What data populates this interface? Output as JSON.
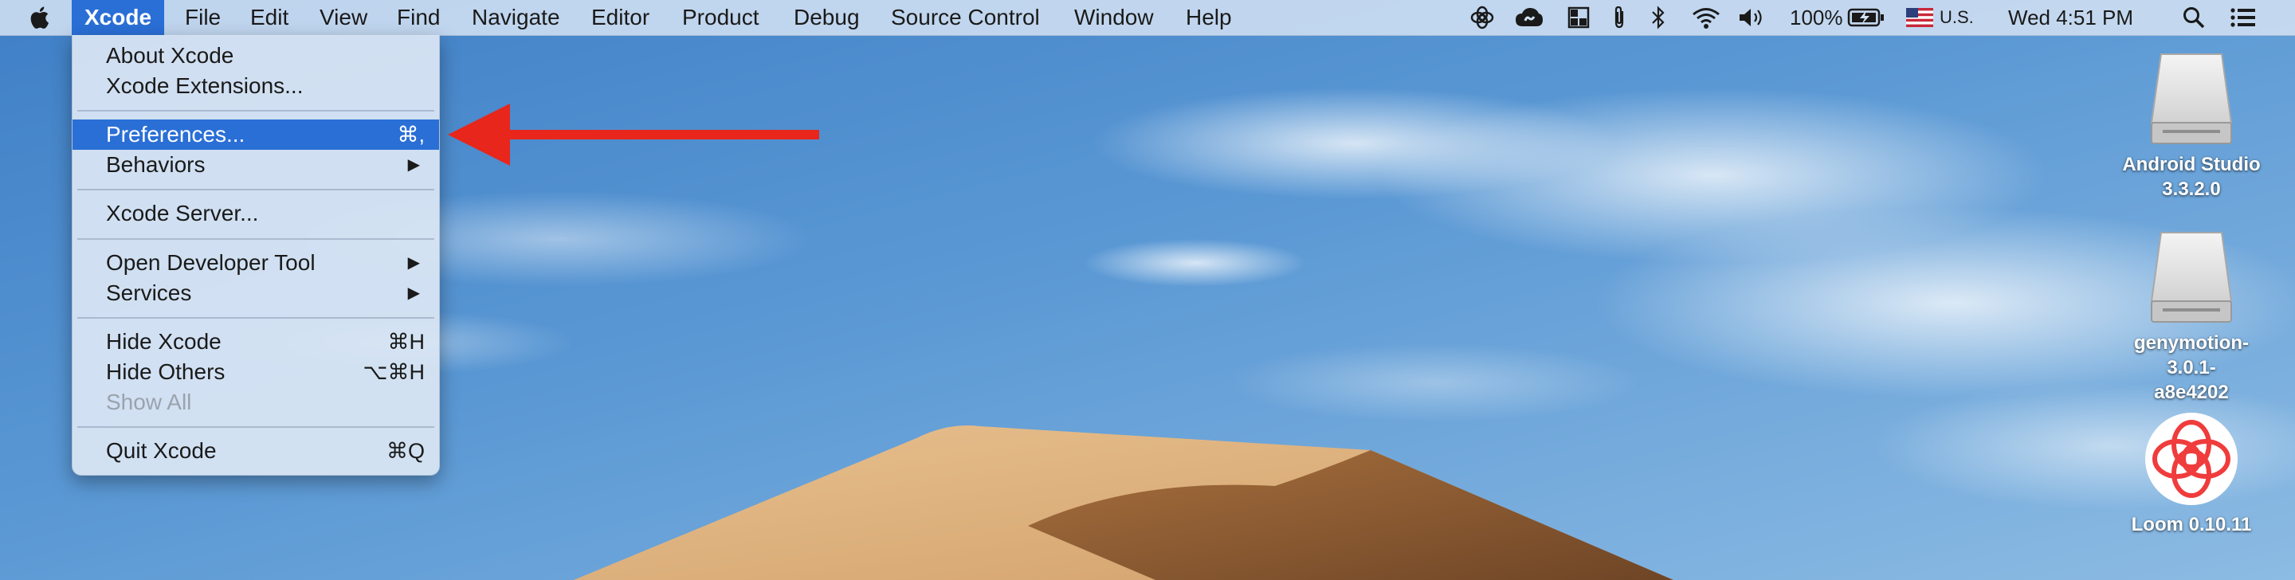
{
  "menubar": {
    "app_name": "Xcode",
    "items": [
      "File",
      "Edit",
      "View",
      "Find",
      "Navigate",
      "Editor",
      "Product",
      "Debug",
      "Source Control",
      "Window",
      "Help"
    ],
    "battery": "100%",
    "input_source": "U.S.",
    "clock": "Wed 4:51 PM"
  },
  "dropdown": {
    "items": [
      {
        "label": "About Xcode"
      },
      {
        "label": "Xcode Extensions..."
      },
      {
        "label": "Preferences...",
        "shortcut": "⌘,"
      },
      {
        "label": "Behaviors",
        "submenu": "▶"
      },
      {
        "label": "Xcode Server..."
      },
      {
        "label": "Open Developer Tool",
        "submenu": "▶"
      },
      {
        "label": "Services",
        "submenu": "▶"
      },
      {
        "label": "Hide Xcode",
        "shortcut": "⌘H"
      },
      {
        "label": "Hide Others",
        "shortcut": "⌥⌘H"
      },
      {
        "label": "Show All"
      },
      {
        "label": "Quit Xcode",
        "shortcut": "⌘Q"
      }
    ]
  },
  "desktop": {
    "icons": [
      {
        "label_line1": "Android Studio",
        "label_line2": "3.3.2.0"
      },
      {
        "label_line1": "genymotion-3.0.1-",
        "label_line2": "a8e4202"
      },
      {
        "label_line1": "Loom 0.10.11",
        "label_line2": ""
      }
    ]
  },
  "colors": {
    "highlight": "#2a6fd6",
    "arrow": "#e8261c",
    "loom": "#f03c3c"
  }
}
